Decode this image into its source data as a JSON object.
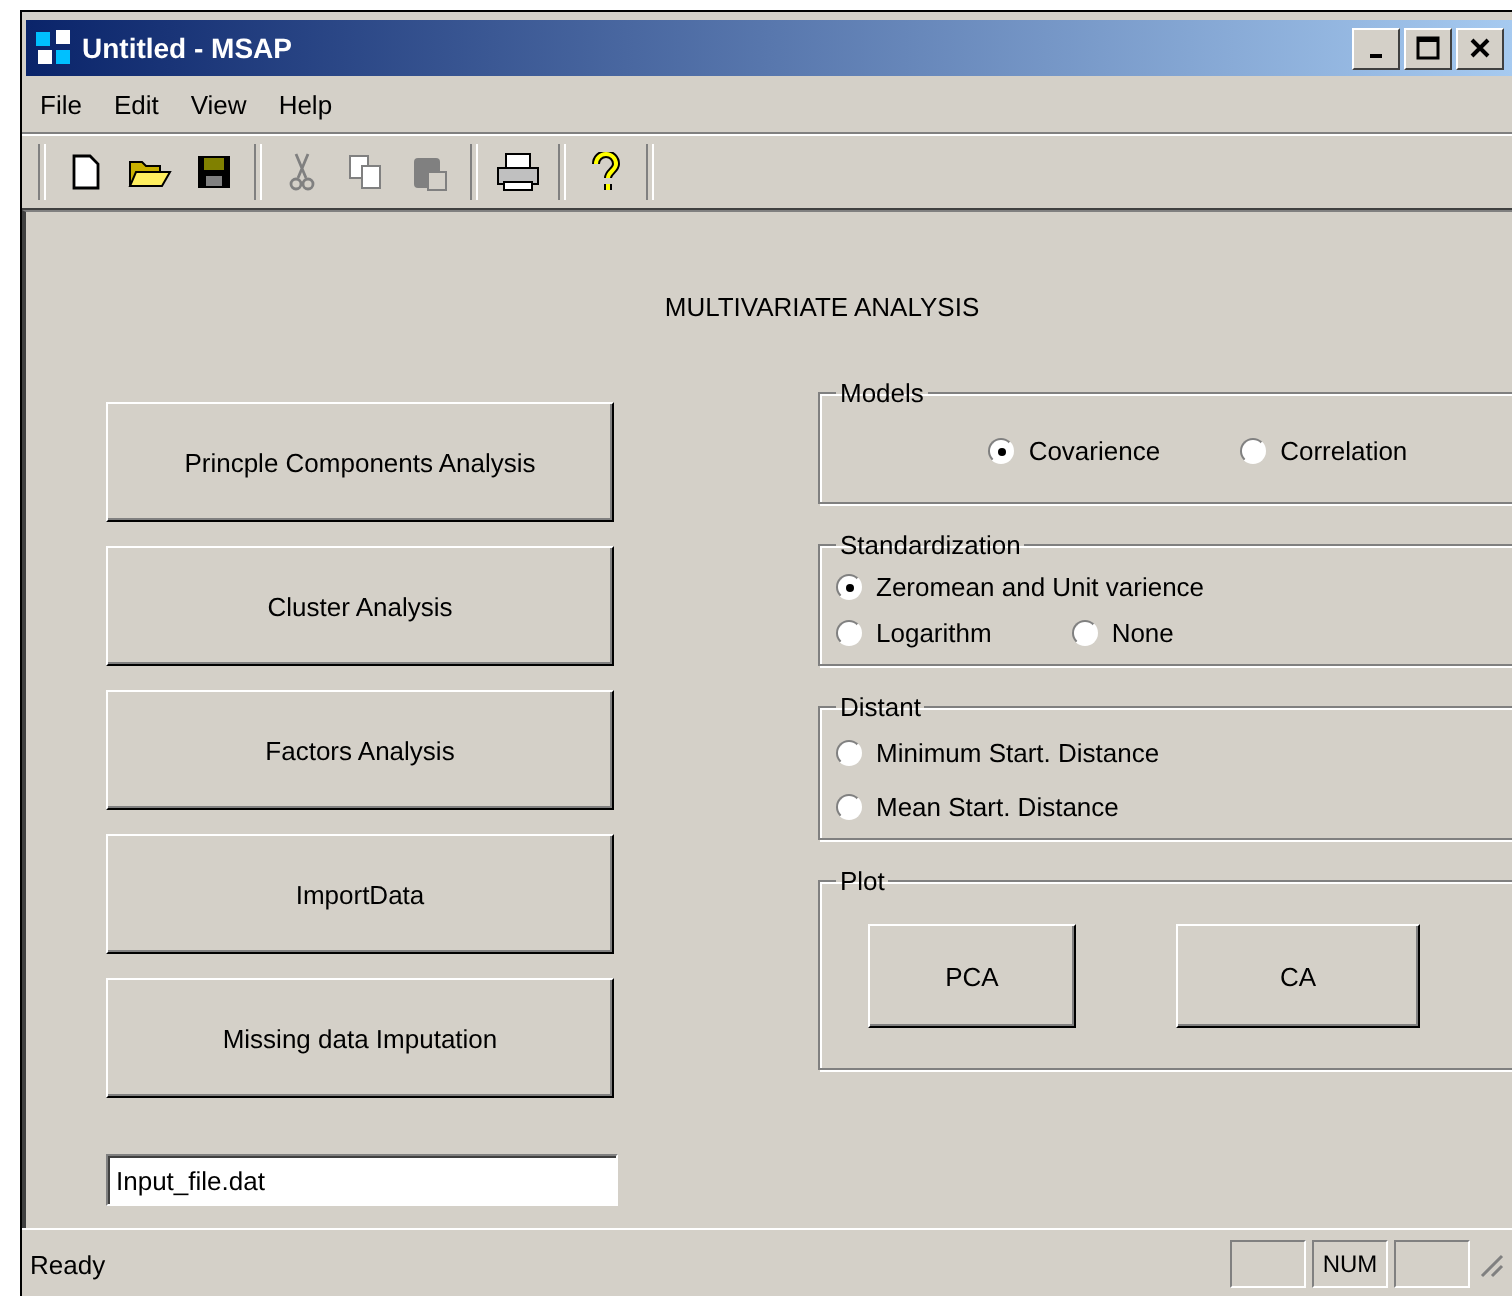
{
  "window": {
    "title": "Untitled - MSAP"
  },
  "menu": [
    "File",
    "Edit",
    "View",
    "Help"
  ],
  "toolbar": [
    {
      "kind": "new"
    },
    {
      "kind": "open"
    },
    {
      "kind": "save"
    },
    {
      "kind": "sep"
    },
    {
      "kind": "cut"
    },
    {
      "kind": "copy"
    },
    {
      "kind": "paste"
    },
    {
      "kind": "sep"
    },
    {
      "kind": "print"
    },
    {
      "kind": "sep"
    },
    {
      "kind": "help"
    },
    {
      "kind": "sep"
    }
  ],
  "heading": "MULTIVARIATE ANALYSIS",
  "buttons": [
    "Princple Components Analysis",
    "Cluster Analysis",
    "Factors Analysis",
    "ImportData",
    "Missing data Imputation"
  ],
  "file_field": {
    "value": "Input_file.dat"
  },
  "groups": [
    {
      "title": "Models",
      "kind": "models",
      "options": [
        {
          "label": "Covarience",
          "selected": true
        },
        {
          "label": "Correlation",
          "selected": false
        }
      ]
    },
    {
      "title": "Standardization",
      "kind": "std",
      "options": [
        {
          "label": "Zeromean and Unit varience",
          "selected": true
        },
        {
          "label": "Logarithm",
          "selected": false
        },
        {
          "label": "None",
          "selected": false
        }
      ]
    },
    {
      "title": "Distant",
      "kind": "dist",
      "options": [
        {
          "label": "Minimum Start. Distance",
          "selected": false
        },
        {
          "label": "Mean Start. Distance",
          "selected": false
        }
      ]
    },
    {
      "title": "Plot",
      "kind": "plot",
      "buttons": [
        "PCA",
        "CA"
      ]
    }
  ],
  "status_bar": {
    "text": "Ready",
    "indicator": "NUM"
  }
}
